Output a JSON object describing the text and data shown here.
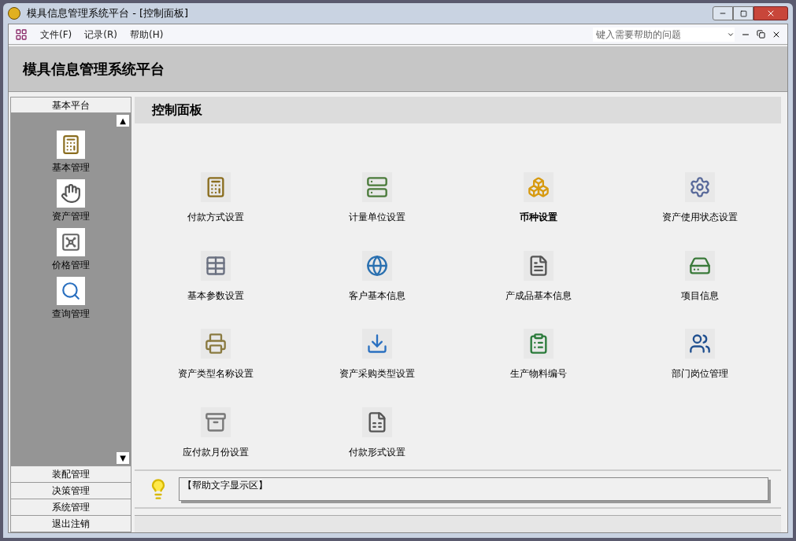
{
  "window": {
    "title": "模具信息管理系统平台 - [控制面板]"
  },
  "menu": [
    {
      "label": "文件(F)"
    },
    {
      "label": "记录(R)"
    },
    {
      "label": "帮助(H)"
    }
  ],
  "help_search": {
    "placeholder": "键入需要帮助的问题"
  },
  "header": {
    "title": "模具信息管理系统平台"
  },
  "sidebar": {
    "open_group": "基本平台",
    "scroll_up": "▲",
    "scroll_down": "▼",
    "items": [
      {
        "label": "基本管理"
      },
      {
        "label": "资产管理"
      },
      {
        "label": "价格管理"
      },
      {
        "label": "查询管理"
      }
    ],
    "groups": [
      {
        "label": "装配管理"
      },
      {
        "label": "决策管理"
      },
      {
        "label": "系统管理"
      },
      {
        "label": "退出注销"
      }
    ]
  },
  "panel": {
    "title": "控制面板",
    "items": [
      {
        "label": "付款方式设置",
        "selected": false
      },
      {
        "label": "计量单位设置",
        "selected": false
      },
      {
        "label": "币种设置",
        "selected": true
      },
      {
        "label": "资产使用状态设置",
        "selected": false
      },
      {
        "label": "基本参数设置",
        "selected": false
      },
      {
        "label": "客户基本信息",
        "selected": false
      },
      {
        "label": "产成品基本信息",
        "selected": false
      },
      {
        "label": "项目信息",
        "selected": false
      },
      {
        "label": "资产类型名称设置",
        "selected": false
      },
      {
        "label": "资产采购类型设置",
        "selected": false
      },
      {
        "label": "生产物料编号",
        "selected": false
      },
      {
        "label": "部门岗位管理",
        "selected": false
      },
      {
        "label": "应付款月份设置",
        "selected": false
      },
      {
        "label": "付款形式设置",
        "selected": false
      }
    ]
  },
  "help_text": "【帮助文字显示区】"
}
